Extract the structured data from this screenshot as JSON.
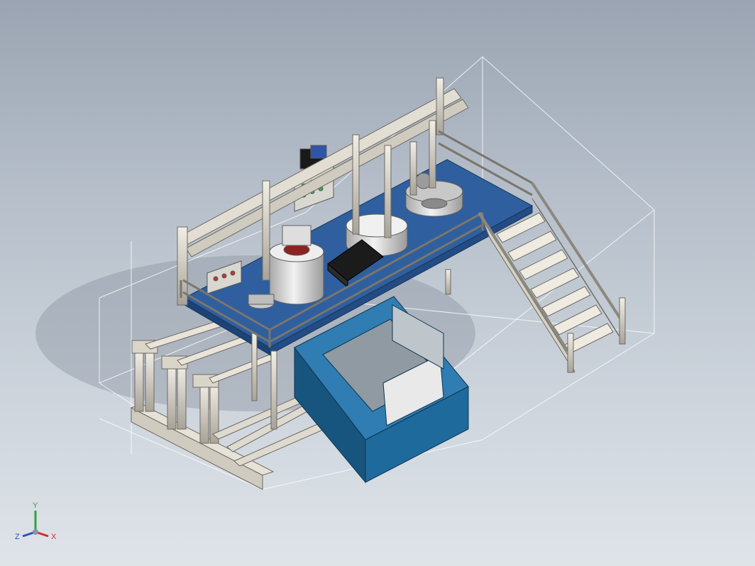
{
  "viewport": {
    "background_top": "#9aa4b2",
    "background_bottom": "#dfe4e9"
  },
  "model": {
    "platform_color": "#2f5f9e",
    "frame_color": "#d8d4c8",
    "enclosure_color": "#1f6a9c",
    "bounding_box_color": "#ffffff"
  },
  "triad": {
    "y_label": "Y",
    "z_label": "Z",
    "x_label": "X",
    "y_color": "#2fa33a",
    "z_color": "#2b4fc7",
    "x_color": "#d12d2d"
  }
}
